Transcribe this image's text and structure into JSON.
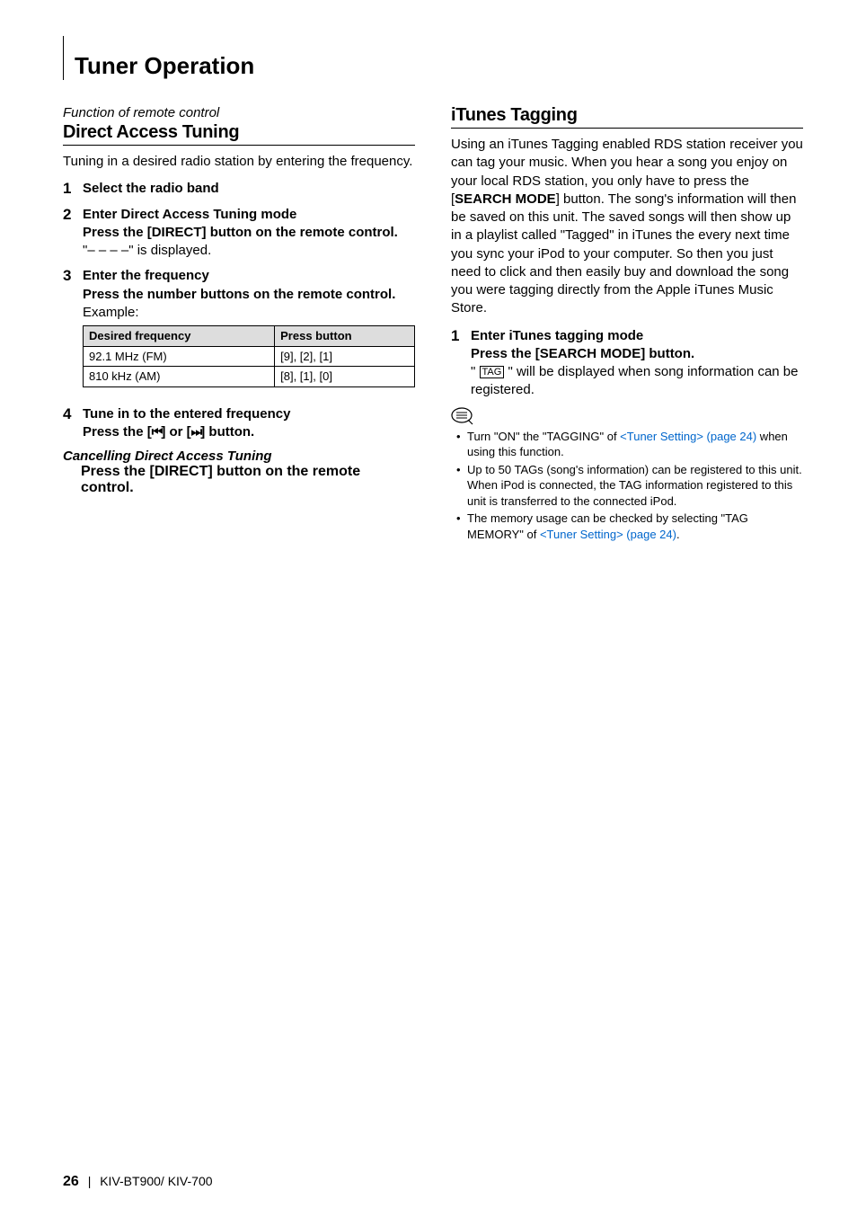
{
  "page_title": "Tuner Operation",
  "footer": {
    "page": "26",
    "model": "KIV-BT900/ KIV-700"
  },
  "left": {
    "function_note": "Function of remote control",
    "heading": "Direct Access Tuning",
    "intro": "Tuning in a desired radio station by entering the frequency.",
    "steps": {
      "s1": {
        "num": "1",
        "title": "Select the radio band"
      },
      "s2": {
        "num": "2",
        "title": "Enter Direct Access Tuning mode",
        "sub": "Press the [DIRECT] button on the remote control.",
        "plain": "\"– – – –\" is displayed."
      },
      "s3": {
        "num": "3",
        "title": "Enter the frequency",
        "sub": "Press the number buttons on the remote control.",
        "example_label": "Example:"
      },
      "s4": {
        "num": "4",
        "title": "Tune in to the entered frequency",
        "sub_prefix": "Press the [",
        "sub_mid": "] or [",
        "sub_suffix": "] button."
      }
    },
    "table": {
      "h1": "Desired frequency",
      "h2": "Press button",
      "r1c1": "92.1 MHz (FM)",
      "r1c2": "[9], [2], [1]",
      "r2c1": "810 kHz (AM)",
      "r2c2": "[8], [1], [0]"
    },
    "cancel": {
      "title": "Cancelling Direct Access Tuning",
      "sub": "Press the [DIRECT] button on the remote control."
    }
  },
  "right": {
    "heading": "iTunes Tagging",
    "intro": "Using an iTunes Tagging enabled RDS station receiver you can tag your music. When you hear a song you enjoy on your local RDS station, you only have to press the [SEARCH MODE] button. The song's information will then be saved on this unit. The saved songs will then show up in a playlist called \"Tagged\" in iTunes the every next time you sync your iPod to your computer. So then you just need to click and then easily buy and download the song you were tagging directly from the Apple iTunes Music Store.",
    "intro_parts": {
      "p1": "Using an iTunes Tagging enabled RDS station receiver you can tag your music. When you hear a song you enjoy on your local RDS station, you only have to press the [",
      "bold1": "SEARCH MODE",
      "p2": "] button. The song's information will then be saved on this unit. The saved songs will then show up in a playlist called \"Tagged\" in iTunes the every next time you sync your iPod to your computer. So then you just need to click and then easily buy and download the song you were tagging directly from the Apple iTunes Music Store."
    },
    "step1": {
      "num": "1",
      "title": "Enter iTunes tagging mode",
      "sub": "Press the [SEARCH MODE] button.",
      "plain_prefix": "\" ",
      "tag_label": "TAG",
      "plain_suffix": " \" will be displayed when song information can be registered."
    },
    "notes": {
      "n1_a": "Turn \"ON\" the \"TAGGING\" of ",
      "n1_link": "<Tuner Setting> (page 24)",
      "n1_b": " when using this function.",
      "n2": "Up to 50 TAGs (song's information) can be registered to this unit. When iPod is connected, the TAG information registered to this unit is transferred to the connected iPod.",
      "n3_a": "The memory usage can be checked by selecting \"TAG MEMORY\" of ",
      "n3_link": "<Tuner Setting> (page 24)",
      "n3_b": "."
    }
  }
}
